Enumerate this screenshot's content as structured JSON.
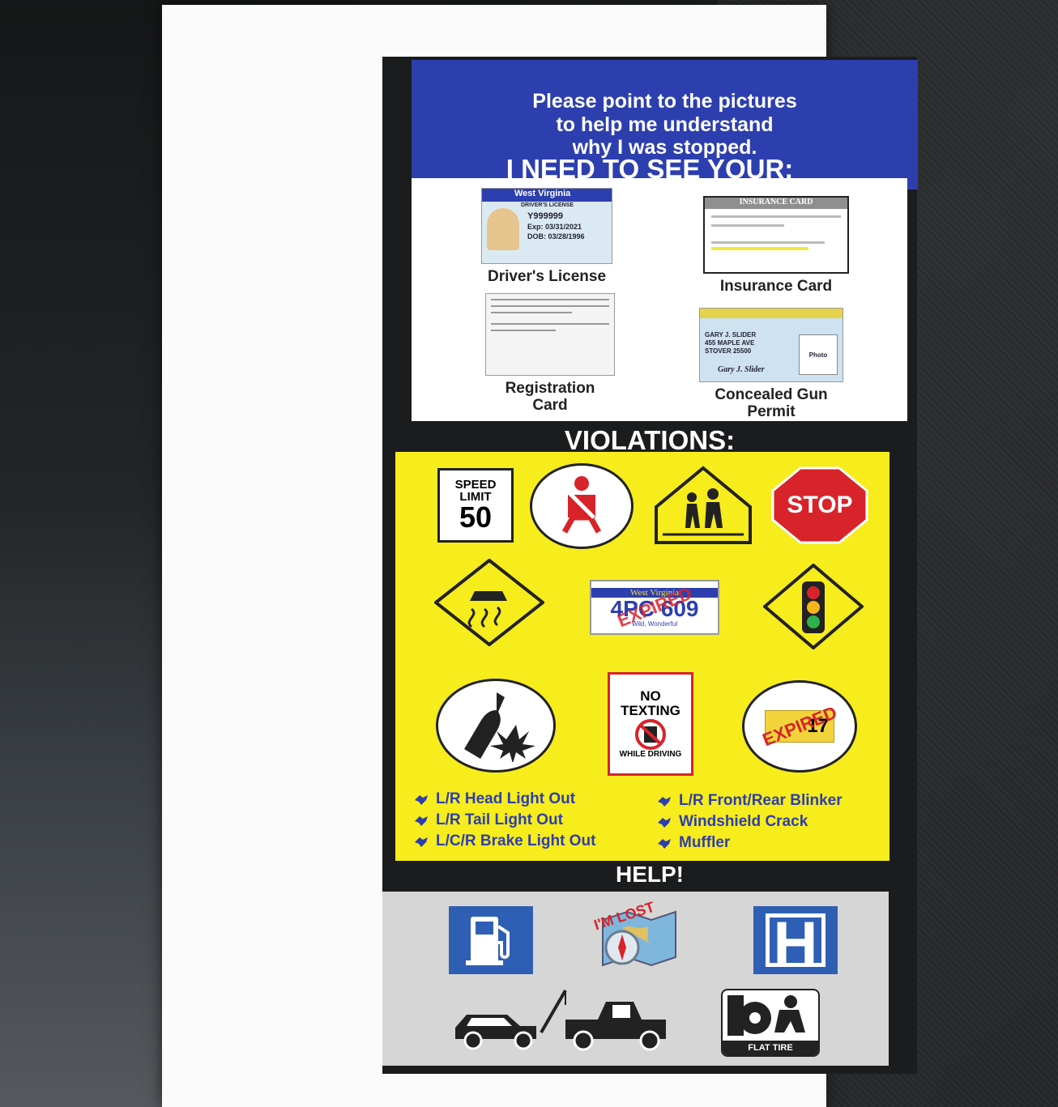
{
  "card": {
    "banner_lines": [
      "Please point to the pictures",
      "to help me understand",
      "why I was stopped."
    ],
    "need_title": "I NEED TO SEE YOUR:",
    "documents": [
      {
        "label": "Driver's License",
        "thumb_header": "West Virginia",
        "thumb_sub": "DRIVER'S LICENSE",
        "thumb_id": "Y999999",
        "thumb_exp": "Exp: 03/31/2021",
        "thumb_dob": "DOB: 03/28/1996"
      },
      {
        "label": "Insurance Card",
        "thumb_header": "INSURANCE CARD"
      },
      {
        "label_line1": "Registration",
        "label_line2": "Card"
      },
      {
        "label_line1": "Concealed Gun",
        "label_line2": "Permit",
        "thumb_name": "GARY J. SLIDER",
        "thumb_addr": "455 MAPLE AVE",
        "thumb_city": "STOVER 25500",
        "thumb_photo": "Photo",
        "thumb_sig": "Gary J. Slider"
      }
    ],
    "violations_title": "VIOLATIONS:",
    "signs": {
      "speed_top": "SPEED",
      "speed_mid": "LIMIT",
      "speed_value": "50",
      "stop": "STOP",
      "plate_state": "West Virginia",
      "plate_number": "4PC 609",
      "plate_motto": "Wild, Wonderful",
      "expired": "EXPIRED",
      "no_texting_1": "NO",
      "no_texting_2": "TEXTING",
      "no_texting_3": "WHILE DRIVING",
      "sticker_year": "17"
    },
    "violation_list_left": [
      "L/R Head Light Out",
      "L/R Tail Light Out",
      "L/C/R Brake Light Out"
    ],
    "violation_list_right": [
      "L/R Front/Rear Blinker",
      "Windshield Crack",
      "Muffler"
    ],
    "help_title": "HELP!",
    "help": {
      "lost": "I'M LOST",
      "flat_tire": "FLAT TIRE",
      "hospital": "H"
    }
  },
  "colors": {
    "banner_blue": "#2d3fae",
    "violation_yellow": "#f7ec1c",
    "stop_red": "#d8232a",
    "text_blue": "#2d3fae"
  }
}
